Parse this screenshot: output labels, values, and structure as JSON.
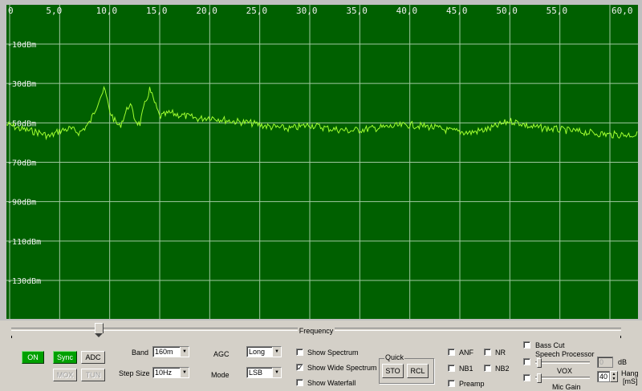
{
  "spectrum": {
    "x_ticks": [
      "0",
      "5,0",
      "10,0",
      "15,0",
      "20,0",
      "25,0",
      "30,0",
      "35,0",
      "40,0",
      "45,0",
      "50,0",
      "55,0",
      "60,0"
    ],
    "y_ticks": [
      "-10dBm",
      "-30dBm",
      "-50dBm",
      "-70dBm",
      "-90dBm",
      "-110dBm",
      "-130dBm"
    ],
    "background": "#006000",
    "grid_color": "#a0c8a0",
    "trace_color": "#a0ff30"
  },
  "chart_data": {
    "type": "line",
    "x_ticks": [
      0,
      5,
      10,
      15,
      20,
      25,
      30,
      35,
      40,
      45,
      50,
      55,
      60
    ],
    "y_ticks": [
      -10,
      -30,
      -50,
      -70,
      -90,
      -110,
      -130
    ],
    "xlim": [
      0,
      60
    ],
    "ylim": [
      -150,
      10
    ],
    "grid": true,
    "series": [
      {
        "x": [
          0,
          1,
          2,
          3,
          4,
          5,
          6,
          7,
          8,
          8.5,
          9,
          9.5,
          10,
          10.5,
          11,
          11.5,
          12,
          12.5,
          13,
          13.5,
          14,
          14.5,
          15,
          16,
          17,
          18,
          19,
          20,
          22,
          24,
          26,
          28,
          30,
          32,
          34,
          36,
          38,
          40,
          42,
          44,
          46,
          48,
          50,
          51,
          52,
          54,
          56,
          58,
          60
        ],
        "y": [
          -51,
          -53,
          -54,
          -55,
          -57,
          -54,
          -53,
          -55,
          -50,
          -44,
          -37,
          -33,
          -44,
          -49,
          -52,
          -46,
          -40,
          -48,
          -51,
          -41,
          -33,
          -40,
          -47,
          -45,
          -46,
          -47,
          -48,
          -47,
          -49,
          -50,
          -52,
          -53,
          -51,
          -53,
          -54,
          -53,
          -52,
          -51,
          -52,
          -54,
          -55,
          -53,
          -49,
          -50,
          -52,
          -53,
          -54,
          -55,
          -56
        ]
      }
    ]
  },
  "frequency": {
    "label": "Frequency",
    "position_fraction": 0.15
  },
  "buttons": {
    "on": "ON",
    "sync": "Sync",
    "adc": "ADC",
    "mox": "MOX",
    "tun": "TUN",
    "sto": "STO",
    "rcl": "RCL"
  },
  "controls": {
    "band_label": "Band",
    "band_value": "160m",
    "step_label": "Step Size",
    "step_value": "10Hz",
    "agc_label": "AGC",
    "agc_value": "Long",
    "mode_label": "Mode",
    "mode_value": "LSB",
    "show_spectrum": "Show Spectrum",
    "show_wide": "Show Wide Spectrum",
    "show_waterfall": "Show Waterfall",
    "quick_label": "Quick",
    "anf": "ANF",
    "nr": "NR",
    "nb1": "NB1",
    "nb2": "NB2",
    "preamp": "Preamp",
    "bass_cut": "Bass Cut",
    "speech_processor": "Speech Processor",
    "db_value": "0",
    "db_unit": "dB",
    "vox": "VOX",
    "hang_value": "40",
    "hang_label": "Hang",
    "hang_unit": "[mS]",
    "mic_gain": "Mic Gain",
    "check_mark": "✓"
  }
}
